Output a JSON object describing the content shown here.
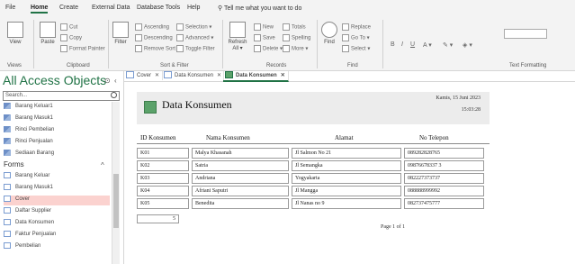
{
  "ribbon_tabs": [
    "File",
    "Home",
    "Create",
    "External Data",
    "Database Tools",
    "Help"
  ],
  "tell_me": "Tell me what you want to do",
  "ribbon": {
    "views": {
      "view_label": "View",
      "group": "Views"
    },
    "clipboard": {
      "paste": "Paste",
      "cut": "Cut",
      "copy": "Copy",
      "format_painter": "Format Painter",
      "group": "Clipboard"
    },
    "sort_filter": {
      "filter": "Filter",
      "ascending": "Ascending",
      "descending": "Descending",
      "remove_sort": "Remove Sort",
      "selection": "Selection",
      "advanced": "Advanced",
      "toggle_filter": "Toggle Filter",
      "group": "Sort & Filter"
    },
    "records": {
      "refresh": "Refresh",
      "all": "All",
      "new": "New",
      "save": "Save",
      "delete": "Delete",
      "totals": "Totals",
      "spelling": "Spelling",
      "more": "More",
      "group": "Records"
    },
    "find": {
      "find": "Find",
      "replace": "Replace",
      "goto": "Go To",
      "select": "Select",
      "group": "Find"
    },
    "text_formatting": {
      "group": "Text Formatting",
      "bold": "B",
      "italic": "I",
      "underline": "U"
    }
  },
  "nav": {
    "title": "All Access Objects",
    "search_placeholder": "Search...",
    "queries": [
      "Barang Keluar1",
      "Barang Masuk1",
      "Rinci Pembelian",
      "Rinci Penjualan",
      "Sediaan Barang"
    ],
    "forms_label": "Forms",
    "forms": [
      "Barang Keluar",
      "Barang Masuk1",
      "Cover",
      "Daftar Supplier",
      "Data Konsumen",
      "Faktur Penjualan",
      "Pembelian"
    ],
    "selected": "Cover"
  },
  "doc_tabs": [
    "Cover",
    "Data Konsumen",
    "Data Konsumen"
  ],
  "report": {
    "title": "Data Konsumen",
    "date": "Kamis, 15 Juni 2023",
    "time": "15:03:28",
    "columns": [
      "ID Konsumen",
      "Nama Konsumen",
      "Alamat",
      "No Telepon"
    ],
    "rows": [
      [
        "K01",
        "Malya Khasanah",
        "Jl Salmon No 21",
        "089282828765"
      ],
      [
        "K02",
        "Satria",
        "Jl Semangka",
        "09876678337 3"
      ],
      [
        "K03",
        "Andriana",
        "Yogyakarta",
        "082227373737"
      ],
      [
        "K04",
        "Afriani Saputri",
        "Jl Mangga",
        "088888999992"
      ],
      [
        "K05",
        "Benedita",
        "Jl Nanas no 9",
        "082737475777"
      ]
    ],
    "count": "5",
    "page": "Page 1 of 1"
  },
  "colors": {
    "accent": "#217346",
    "selected_nav": "#fbd2cf",
    "header_band": "#ececec"
  }
}
